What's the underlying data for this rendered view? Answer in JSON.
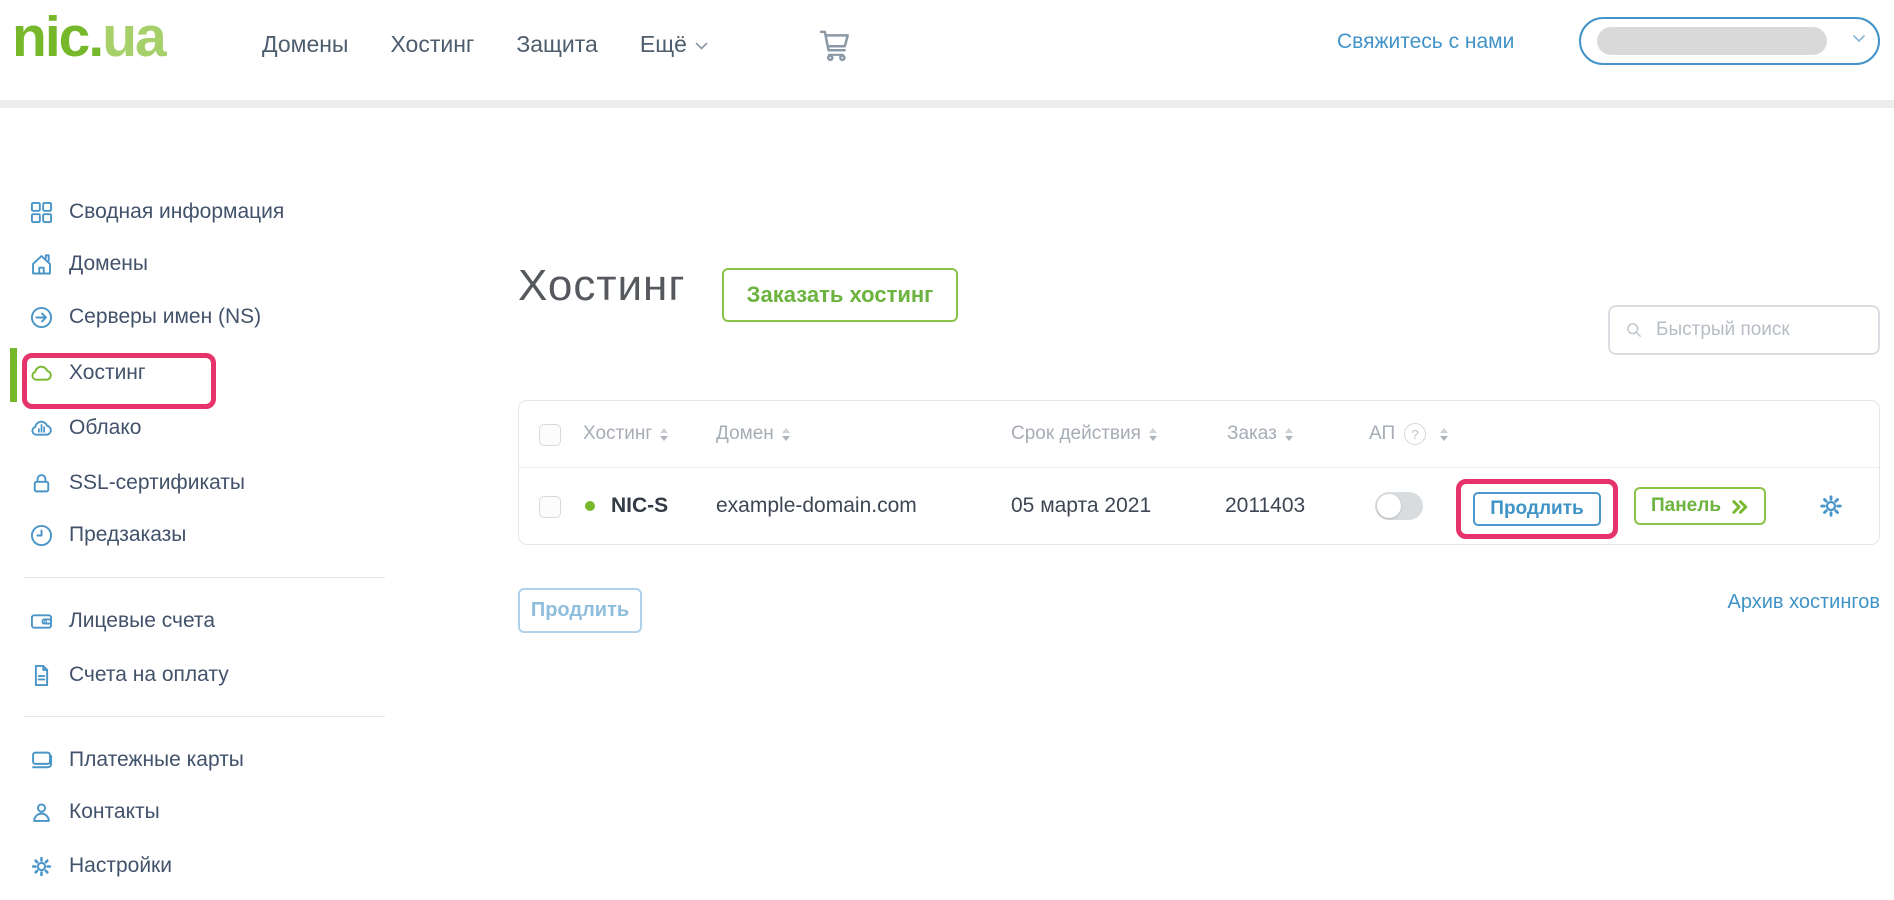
{
  "brand": {
    "part1": "nic.",
    "part2": "ua"
  },
  "nav": {
    "items": [
      {
        "label": "Домены"
      },
      {
        "label": "Хостинг"
      },
      {
        "label": "Защита"
      },
      {
        "label": "Ещё"
      }
    ],
    "contact_link": "Свяжитесь с нами"
  },
  "sidebar": {
    "items": [
      {
        "label": "Сводная информация",
        "icon": "grid-icon"
      },
      {
        "label": "Домены",
        "icon": "home-icon"
      },
      {
        "label": "Серверы имен (NS)",
        "icon": "arrow-circle-icon"
      },
      {
        "label": "Хостинг",
        "icon": "cloud-icon",
        "active": true,
        "highlighted": true
      },
      {
        "label": "Облако",
        "icon": "cloud-chart-icon"
      },
      {
        "label": "SSL-сертификаты",
        "icon": "lock-icon"
      },
      {
        "label": "Предзаказы",
        "icon": "clock-icon"
      },
      {
        "label": "Лицевые счета",
        "icon": "wallet-icon"
      },
      {
        "label": "Счета на оплату",
        "icon": "invoice-icon"
      },
      {
        "label": "Платежные карты",
        "icon": "cards-icon"
      },
      {
        "label": "Контакты",
        "icon": "person-icon"
      },
      {
        "label": "Настройки",
        "icon": "gear-icon"
      }
    ]
  },
  "main": {
    "title": "Хостинг",
    "order_button": "Заказать хостинг",
    "search_placeholder": "Быстрый поиск",
    "table": {
      "headers": {
        "hosting": "Хостинг",
        "domain": "Домен",
        "term": "Срок действия",
        "order": "Заказ",
        "autorenew": "АП",
        "autorenew_help": "?"
      },
      "rows": [
        {
          "status": "active",
          "name": "NIC-S",
          "domain": "example-domain.com",
          "term": "05 марта 2021",
          "order": "2011403",
          "autorenew_on": false,
          "renew_label": "Продлить",
          "panel_label": "Панель"
        }
      ]
    },
    "footer": {
      "renew_button": "Продлить",
      "archive_link": "Архив хостингов"
    }
  },
  "colors": {
    "brand_green": "#76b82a",
    "accent_blue": "#4193c8",
    "annotation_pink": "#e6336b",
    "button_green": "#6cb33f",
    "toggle_off_gray": "#d9dcdf"
  }
}
